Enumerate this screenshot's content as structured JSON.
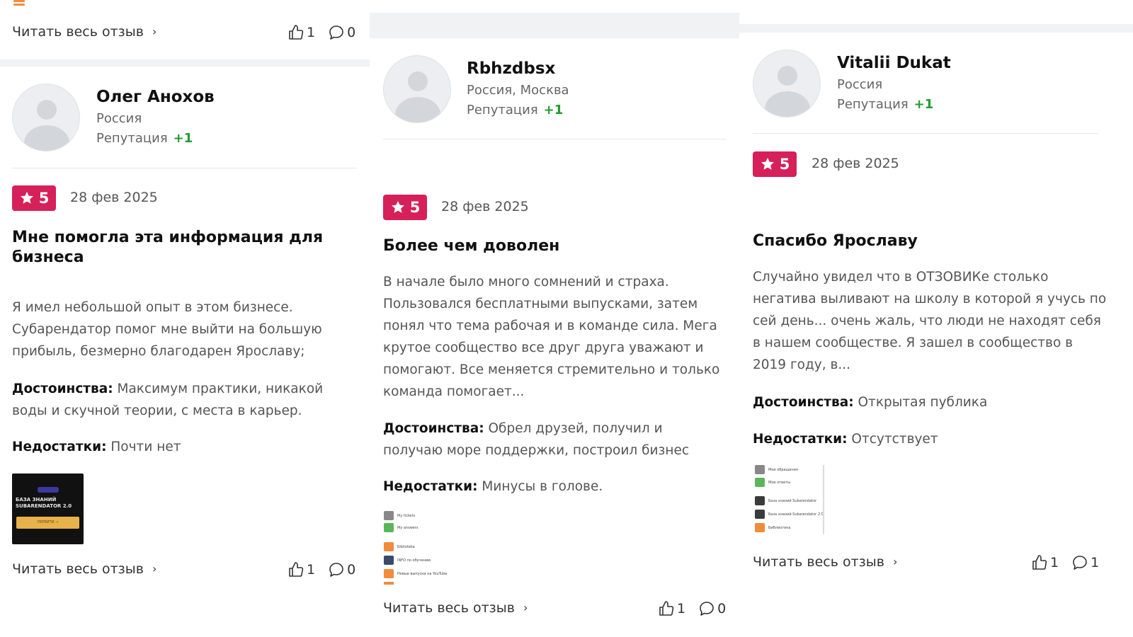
{
  "ui": {
    "read_more": "Читать весь отзыв",
    "chevron": "›",
    "reputation_label": "Репутация",
    "pros_label": "Достоинства:",
    "cons_label": "Недостатки:",
    "accent_color": "#d6205a",
    "positive_color": "#1f9c2f"
  },
  "col1_prev": {
    "likes": "1",
    "comments": "0"
  },
  "reviews": [
    {
      "user": {
        "name": "Олег Анохов",
        "location": "Россия",
        "reputation": "+1"
      },
      "rating": "5",
      "date": "28 фев 2025",
      "title": "Мне помогла эта информация для бизнеса",
      "text": "Я имел небольшой опыт в этом бизнесе. Субарендатор помог мне выйти на большую прибыль, безмерно благодарен Ярославу;",
      "pros": "Максимум практики, никакой воды и скучной теории, с места в карьер.",
      "cons": "Почти нет",
      "image": {
        "badge_icon": "subarendator-badge",
        "title": "БАЗА ЗНАНИЙ SUBARENDATOR 2.0",
        "button": "ПЕРЕЙТИ →"
      },
      "likes": "1",
      "comments": "0"
    },
    {
      "user": {
        "name": "Rbhzdbsx",
        "location": "Россия, Москва",
        "reputation": "+1"
      },
      "rating": "5",
      "date": "28 фев 2025",
      "title": "Более чем доволен",
      "text": "В начале было много сомнений и страха. Пользовался бесплатными выпусками, затем понял что тема рабочая и в команде сила. Мега крутое сообщество все друг друга уважают и помогают. Все меняется стремительно и только команда помогает...",
      "pros": "Обрел друзей, получил и получаю море поддержки, построил бизнес",
      "cons": "Минусы в голове.",
      "image_rows": [
        {
          "label": "My tickets",
          "color": "#888888"
        },
        {
          "label": "My answers",
          "color": "#5bb65b"
        },
        {
          "label": "Бiblioteka",
          "color": "#f08c3c"
        },
        {
          "label": "INFO по обучению",
          "color": "#3b4a6b"
        },
        {
          "label": "Новые выпуски на YouTube",
          "color": "#f08c3c"
        }
      ],
      "likes": "1",
      "comments": "0"
    },
    {
      "user": {
        "name": "Vitalii Dukat",
        "location": "Россия",
        "reputation": "+1"
      },
      "rating": "5",
      "date": "28 фев 2025",
      "title": "Спасибо Ярославу",
      "text": "Случайно увидел что в ОТЗОВИКе столько негатива выливают на школу в которой я учусь по сей день... очень жаль, что люди не находят себя в нашем сообществе. Я зашел в сообщество в 2019 году, в...",
      "pros": "Открытая публика",
      "cons": "Отсутствует",
      "image_rows": [
        {
          "label": "Мои обращения",
          "color": "#888888"
        },
        {
          "label": "Мои ответы",
          "color": "#5bb65b"
        },
        {
          "label": "База знаний Subarendator",
          "color": "#3b3b3b"
        },
        {
          "label": "База знаний Subarendator 2.0",
          "color": "#3b3b3b"
        },
        {
          "label": "Библиотека",
          "color": "#f08c3c"
        }
      ],
      "likes": "1",
      "comments": "1"
    }
  ]
}
